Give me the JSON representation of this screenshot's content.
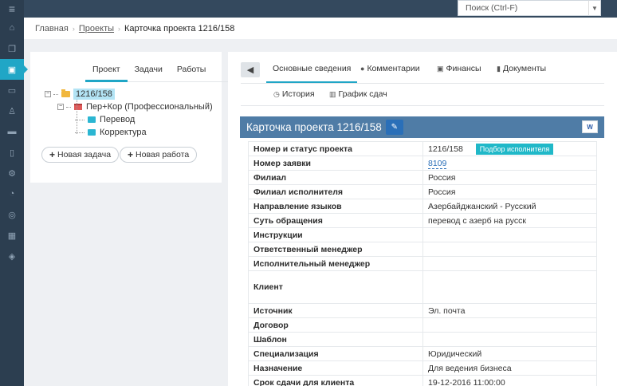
{
  "app": {
    "search_placeholder": "Поиск (Ctrl-F)"
  },
  "breadcrumb": {
    "home": "Главная",
    "projects": "Проекты",
    "current": "Карточка проекта 1216/158"
  },
  "left_panel": {
    "tabs": [
      {
        "label": "Проект",
        "active": true
      },
      {
        "label": "Задачи",
        "active": false
      },
      {
        "label": "Работы",
        "active": false
      }
    ],
    "tree": {
      "root": "1216/158",
      "child": "Пер+Кор (Профессиональный)",
      "leaves": [
        "Перевод",
        "Корректура"
      ]
    },
    "new_task_label": "Новая задача",
    "new_work_label": "Новая работа"
  },
  "right_panel": {
    "tabs_row1": [
      {
        "label": "Основные сведения",
        "icon": "",
        "active": true
      },
      {
        "label": "Комментарии",
        "icon": "comment-icon",
        "active": false
      },
      {
        "label": "Финансы",
        "icon": "money-icon",
        "active": false
      },
      {
        "label": "Документы",
        "icon": "document-icon",
        "active": false
      }
    ],
    "tabs_row2": [
      {
        "label": "История",
        "icon": "clock-icon"
      },
      {
        "label": "График сдач",
        "icon": "bar-chart-icon"
      }
    ],
    "card_title": "Карточка проекта 1216/158",
    "fields": [
      {
        "key": "Номер и статус проекта",
        "value": "1216/158",
        "badge": "Подбор исполнителя"
      },
      {
        "key": "Номер заявки",
        "value": "8109",
        "link": true
      },
      {
        "key": "Филиал",
        "value": "Россия"
      },
      {
        "key": "Филиал исполнителя",
        "value": "Россия"
      },
      {
        "key": "Направление языков",
        "value": "Азербайджанский - Русский"
      },
      {
        "key": "Суть обращения",
        "value": "перевод с азерб на русск"
      },
      {
        "key": "Инструкции",
        "value": ""
      },
      {
        "key": "Ответственный менеджер",
        "value": ""
      },
      {
        "key": "Исполнительный менеджер",
        "value": ""
      },
      {
        "key": "Клиент",
        "value": "",
        "tall": true
      },
      {
        "key": "Источник",
        "value": "Эл. почта"
      },
      {
        "key": "Договор",
        "value": ""
      },
      {
        "key": "Шаблон",
        "value": ""
      },
      {
        "key": "Специализация",
        "value": "Юридический"
      },
      {
        "key": "Назначение",
        "value": "Для ведения бизнеса"
      },
      {
        "key": "Срок сдачи для клиента",
        "value": "19-12-2016 11:00:00"
      }
    ]
  },
  "colors": {
    "accent": "#20a6c6",
    "sidebar": "#2c3e50",
    "card_header": "#4f7ca6"
  }
}
